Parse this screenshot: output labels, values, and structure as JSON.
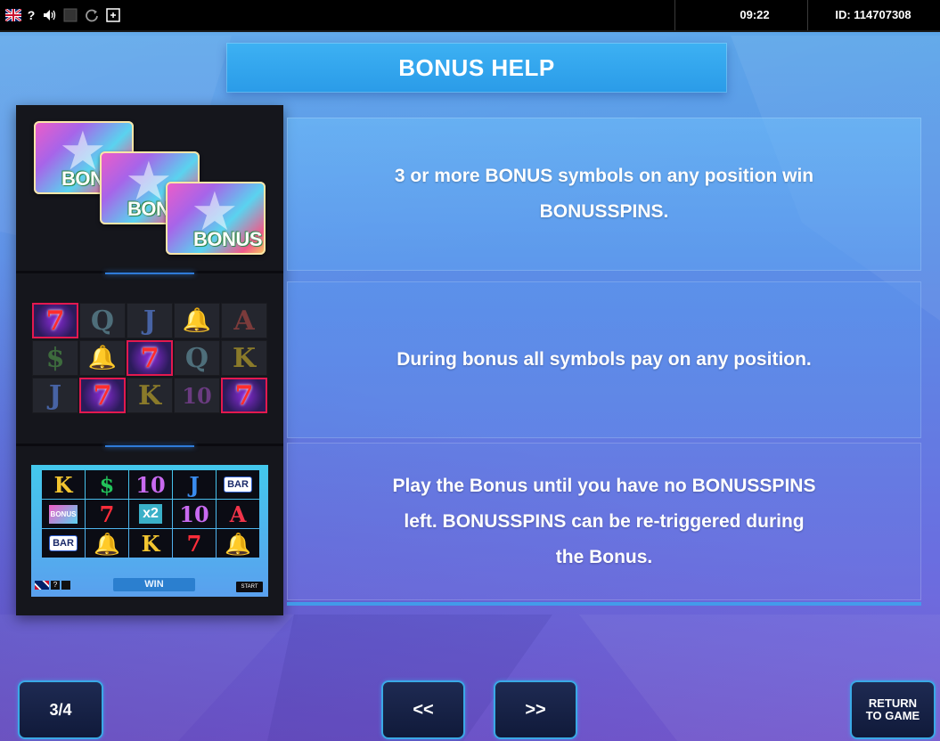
{
  "status_bar": {
    "icons": [
      "uk-flag-icon",
      "help-icon",
      "sound-icon",
      "fullscreen-icon",
      "reload-icon",
      "window-icon"
    ],
    "help_glyph": "?",
    "time": "09:22",
    "game_id": "ID: 114707308"
  },
  "title": "BONUS HELP",
  "illustrations": {
    "bonus_cards": [
      "BONUS",
      "BONUS",
      "BONUS"
    ],
    "symbol_grid": [
      [
        "7",
        "Q",
        "J",
        "🔔",
        "A"
      ],
      [
        "$",
        "🔔",
        "7",
        "Q",
        "K"
      ],
      [
        "J",
        "7",
        "K",
        "10",
        "7"
      ]
    ],
    "mini_game": {
      "reels": [
        [
          "K",
          "$",
          "10",
          "J",
          "BAR"
        ],
        [
          "BONUS",
          "7",
          "x2",
          "10",
          "A"
        ],
        [
          "BAR",
          "🔔",
          "K",
          "7",
          "🔔"
        ]
      ],
      "win_label": "WIN",
      "start_label": "START"
    }
  },
  "panels": [
    {
      "text": "3 or more BONUS symbols on any position win BONUSSPINS."
    },
    {
      "text": "During bonus all symbols pay on any position."
    },
    {
      "text": "Play the Bonus until you have no BONUSSPINS left. BONUSSPINS can be re-triggered during the Bonus."
    }
  ],
  "navigation": {
    "page_indicator": "3/4",
    "prev_label": "<<",
    "next_label": ">>",
    "return_line1": "RETURN",
    "return_line2": "TO GAME"
  },
  "colors": {
    "accent": "#3aa9e6",
    "title_bg": "#2a9be8",
    "button_bg": "#101a3a",
    "highlight": "#e3194f"
  }
}
